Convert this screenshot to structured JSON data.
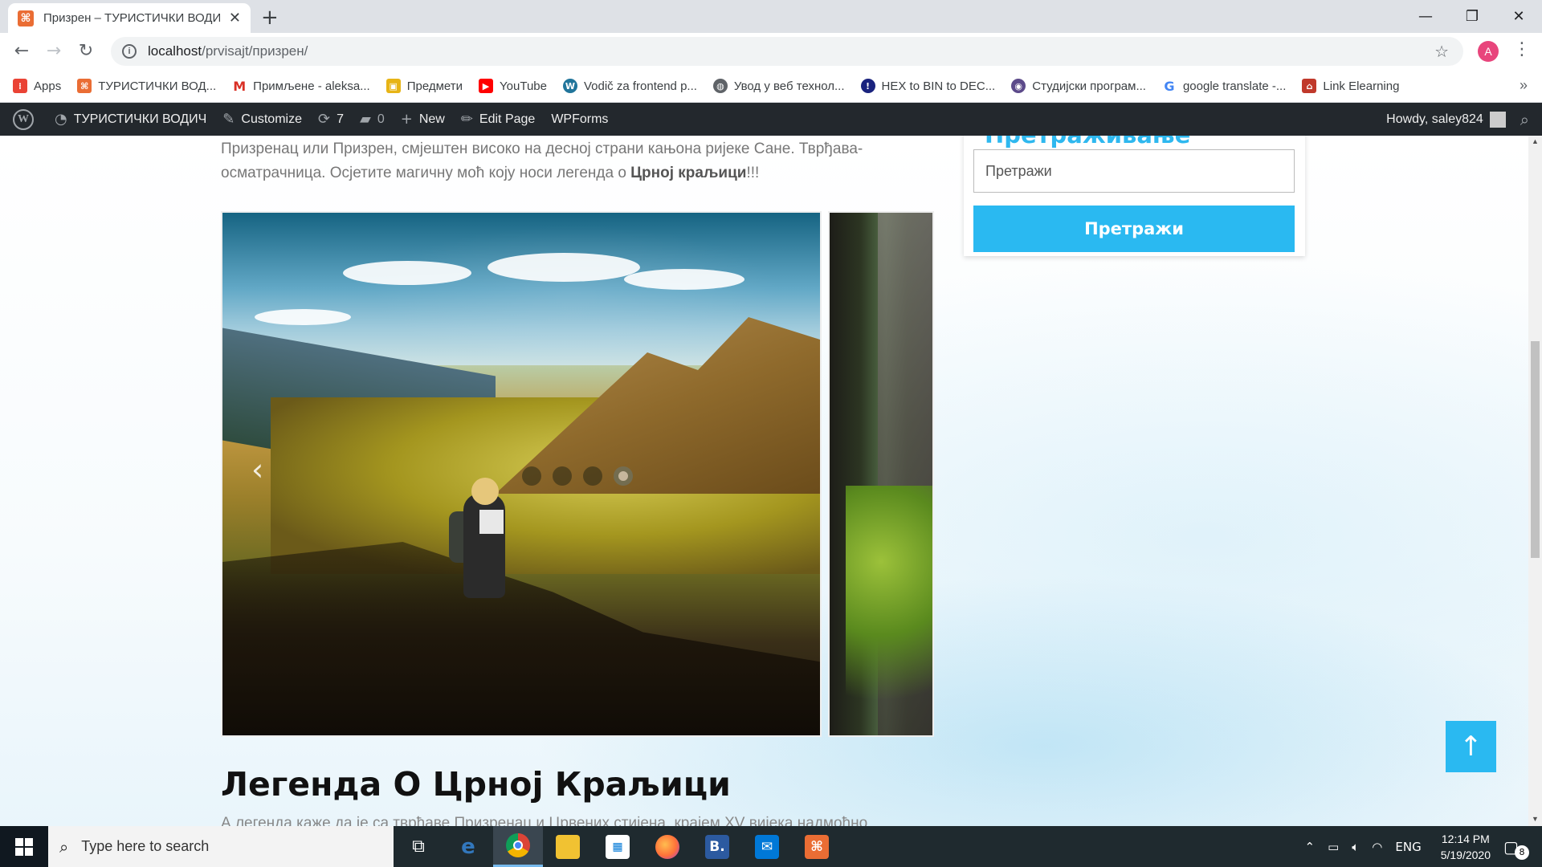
{
  "browser": {
    "tab_title": "Призрен – ТУРИСТИЧКИ ВОДИЧ",
    "url_host": "localhost",
    "url_path": "/prvisajt/призрен/",
    "profile_initial": "A"
  },
  "bookmarks": [
    {
      "label": "Apps",
      "icon": "apps-grid-icon",
      "color": "#ea4335"
    },
    {
      "label": "ТУРИСТИЧКИ ВОД...",
      "icon": "xampp-icon",
      "color": "#ea6d34"
    },
    {
      "label": "Примљене - aleksa...",
      "icon": "gmail-icon",
      "color": "#d93025"
    },
    {
      "label": "Предмети",
      "icon": "moodle-icon",
      "color": "#e7b416"
    },
    {
      "label": "YouTube",
      "icon": "youtube-icon",
      "color": "#ff0000"
    },
    {
      "label": "Vodič za frontend p...",
      "icon": "wordpress-icon",
      "color": "#21759b"
    },
    {
      "label": "Увод у веб технол...",
      "icon": "globe-icon",
      "color": "#5f6368"
    },
    {
      "label": "HEX to BIN to DEC...",
      "icon": "shield-icon",
      "color": "#1a237e"
    },
    {
      "label": "Студијски програм...",
      "icon": "university-icon",
      "color": "#5c4a8a"
    },
    {
      "label": "google translate -...",
      "icon": "google-icon",
      "color": "#4285f4"
    },
    {
      "label": "Link Elearning",
      "icon": "elearning-icon",
      "color": "#c0392b"
    }
  ],
  "adminbar": {
    "site_name": "ТУРИСТИЧКИ ВОДИЧ",
    "customize": "Customize",
    "updates": "7",
    "comments": "0",
    "new": "New",
    "edit_page": "Edit Page",
    "wpforms": "WPForms",
    "howdy": "Howdy, saley824"
  },
  "page": {
    "intro_text": "Призренац или Призрен, смјештен високо на десној страни кањона ријеке Сане. Тврђава-осматрачница. Осјетите магичну моћ коју носи легенда о ",
    "intro_bold": "Црној краљици",
    "intro_end": "!!!",
    "slider_dots": 4,
    "slider_active_dot": 4,
    "legend_title": "Легенда О Црној Краљици",
    "legend_text": "А легенда каже да је са тврђаве Призренац и Црвених стијена, крајем XV вијека надмоћно"
  },
  "widget": {
    "title": "Претраживање",
    "search_placeholder": "Претражи",
    "search_button": "Претражи"
  },
  "taskbar": {
    "search_placeholder": "Type here to search",
    "language": "ENG",
    "time": "12:14 PM",
    "date": "5/19/2020",
    "notifications": "8"
  }
}
